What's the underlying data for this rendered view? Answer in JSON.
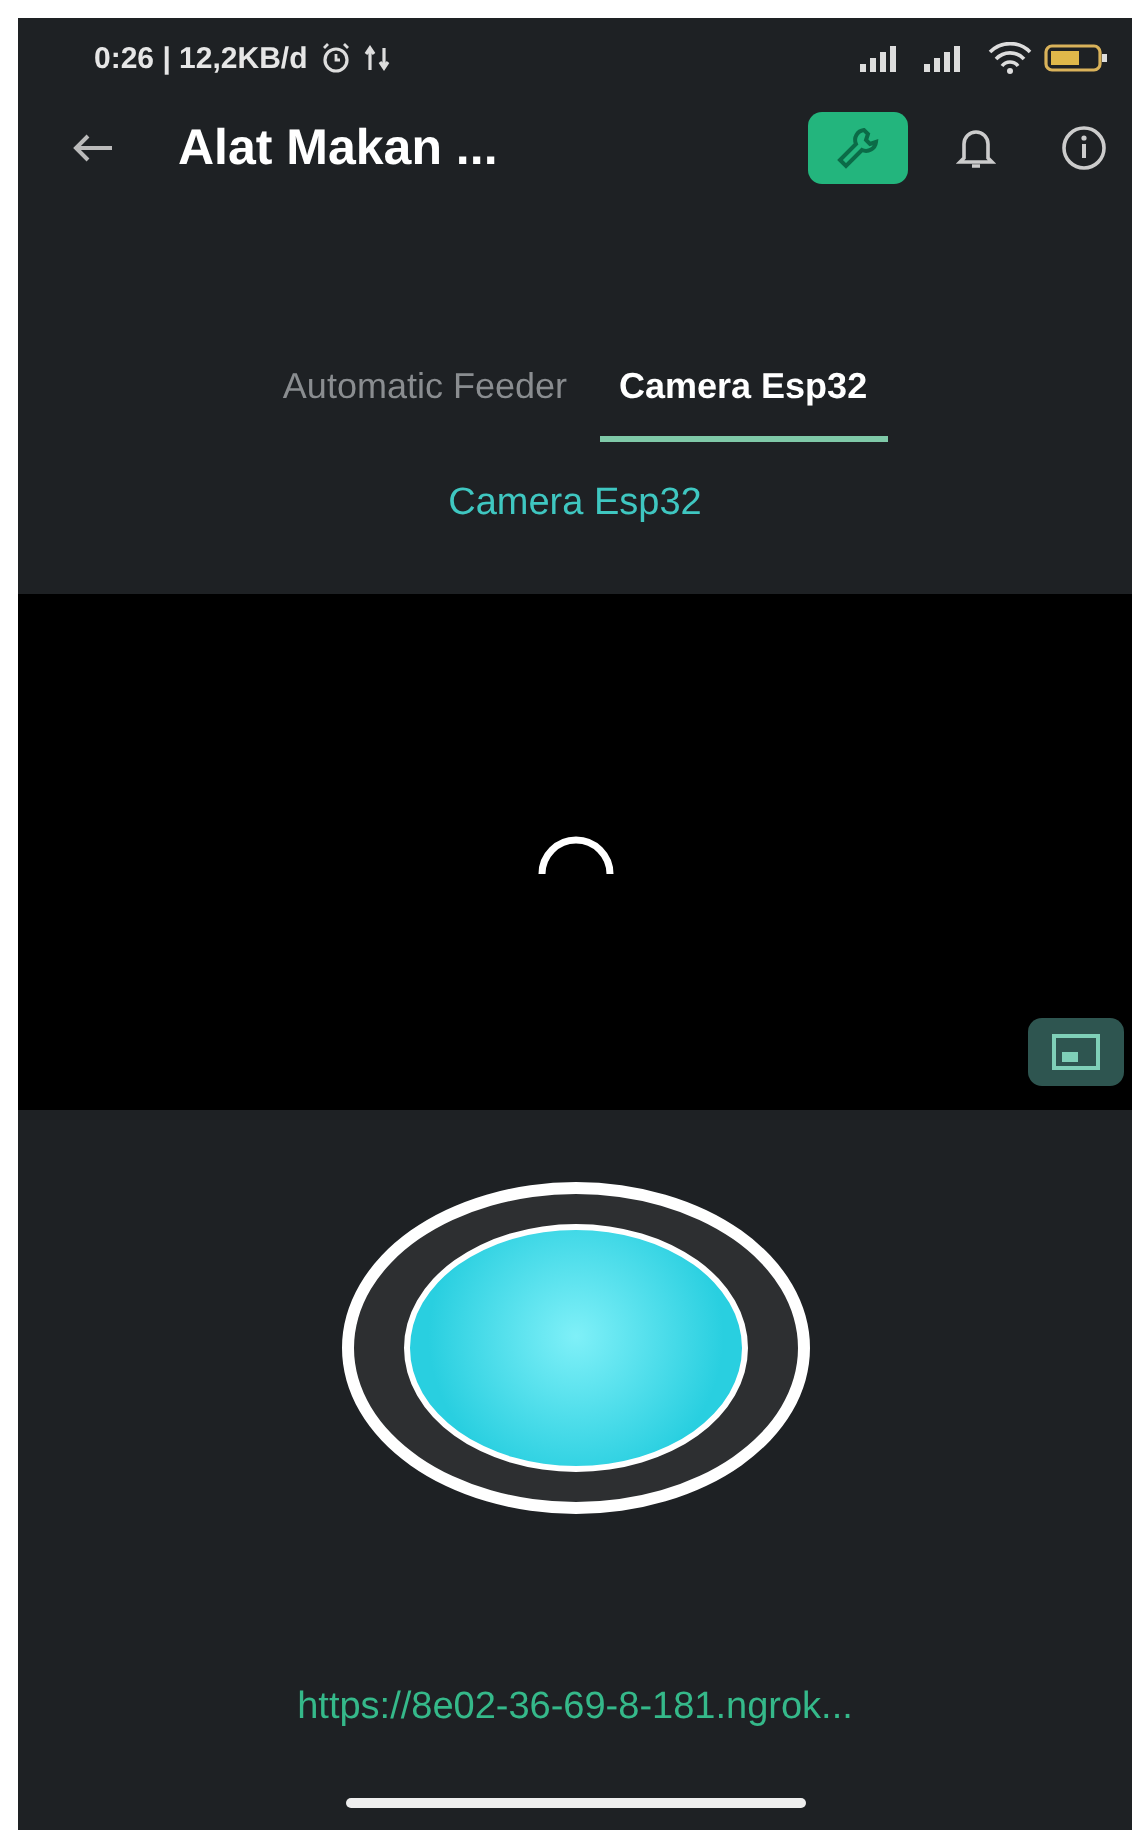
{
  "status_bar": {
    "time": "0:26 | 12,2KB/d"
  },
  "app_bar": {
    "title": "Alat Makan ..."
  },
  "tabs": [
    {
      "label": "Automatic Feeder",
      "selected": false
    },
    {
      "label": "Camera Esp32",
      "selected": true
    }
  ],
  "widget_title": "Camera Esp32",
  "video": {
    "loading": true
  },
  "capture_button": {
    "pressed": false
  },
  "url": "https://8e02-36-69-8-181.ngrok..."
}
